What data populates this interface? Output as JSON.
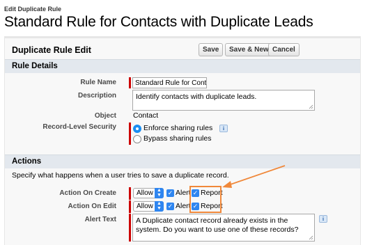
{
  "header": {
    "breadcrumb": "Edit Duplicate Rule",
    "title": "Standard Rule for Contacts with Duplicate Leads"
  },
  "panel": {
    "title": "Duplicate Rule Edit",
    "buttons": {
      "save": "Save",
      "save_new": "Save & New",
      "cancel": "Cancel"
    }
  },
  "rule_details": {
    "section_title": "Rule Details",
    "rule_name_label": "Rule Name",
    "rule_name_value": "Standard Rule for Conta",
    "description_label": "Description",
    "description_value": "Identify contacts with duplicate leads.",
    "object_label": "Object",
    "object_value": "Contact",
    "security_label": "Record-Level Security",
    "security_options": [
      "Enforce sharing rules",
      "Bypass sharing rules"
    ],
    "security_selected": "Enforce sharing rules"
  },
  "actions": {
    "section_title": "Actions",
    "intro": "Specify what happens when a user tries to save a duplicate record.",
    "on_create_label": "Action On Create",
    "on_create_value": "Allow",
    "on_edit_label": "Action On Edit",
    "on_edit_value": "Allow",
    "alert_label": "Alert",
    "report_label": "Report",
    "alert_text_label": "Alert Text",
    "alert_text_value": "A Duplicate contact record already exists in the system. Do you want to use one of these records?"
  },
  "colors": {
    "accent": "#2f86f0",
    "required": "#cc0000",
    "annotation": "#f0883a",
    "section_bar": "#e3e8ee"
  },
  "icons": [
    "radio-selected-icon",
    "info-icon",
    "select-arrow-icon",
    "checkbox-checked-icon",
    "resize-grip-icon",
    "annotation-arrow-icon"
  ]
}
